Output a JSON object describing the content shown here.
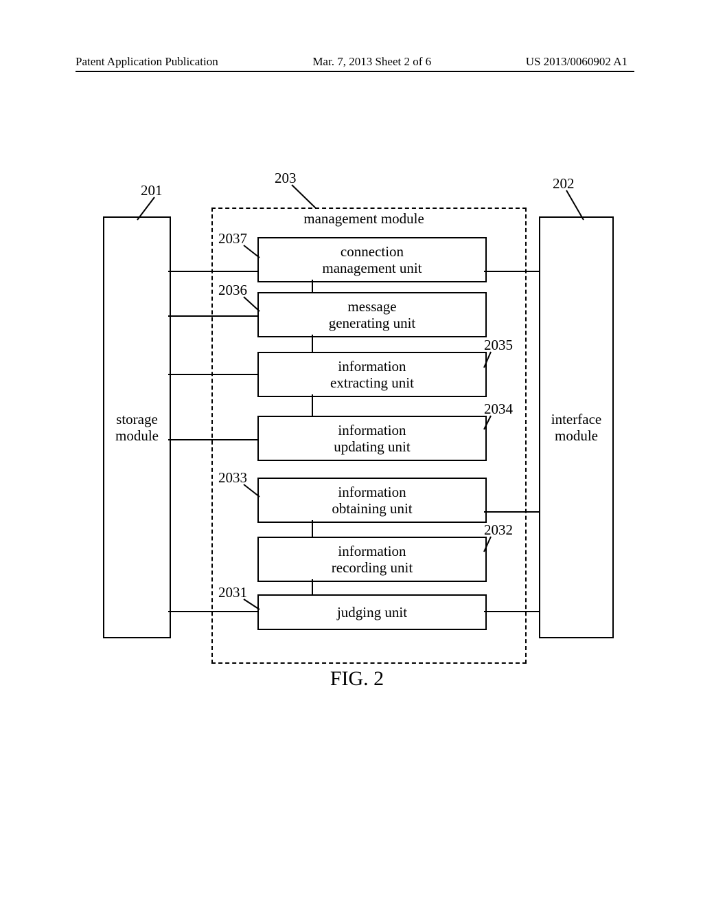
{
  "header": {
    "left": "Patent Application Publication",
    "center": "Mar. 7, 2013  Sheet 2 of 6",
    "right": "US 2013/0060902 A1"
  },
  "nums": {
    "n201": "201",
    "n202": "202",
    "n203": "203",
    "n2031": "2031",
    "n2032": "2032",
    "n2033": "2033",
    "n2034": "2034",
    "n2035": "2035",
    "n2036": "2036",
    "n2037": "2037"
  },
  "blocks": {
    "storage": "storage\nmodule",
    "interface": "interface\nmodule",
    "mgmt_title": "management module",
    "u2037": "connection\nmanagement unit",
    "u2036": "message\ngenerating unit",
    "u2035": "information\nextracting unit",
    "u2034": "information\nupdating unit",
    "u2033": "information\nobtaining unit",
    "u2032": "information\nrecording unit",
    "u2031": "judging unit"
  },
  "caption": "FIG. 2"
}
